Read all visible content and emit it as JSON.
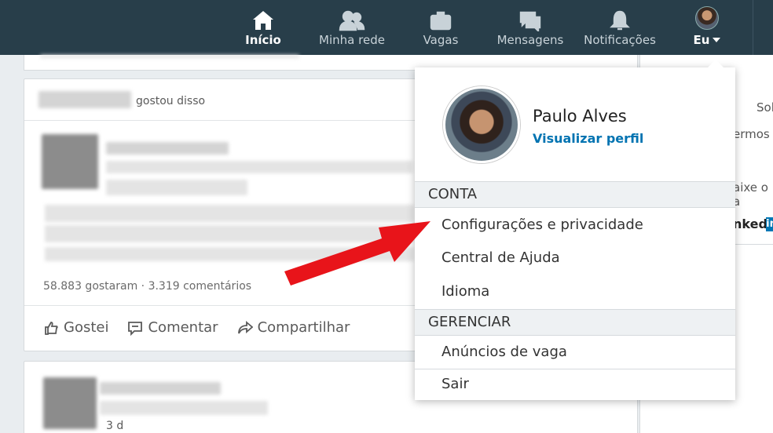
{
  "nav": {
    "items": [
      {
        "label": "Início",
        "icon": "home-icon",
        "active": true
      },
      {
        "label": "Minha rede",
        "icon": "people-icon"
      },
      {
        "label": "Vagas",
        "icon": "briefcase-icon"
      },
      {
        "label": "Mensagens",
        "icon": "messages-icon"
      },
      {
        "label": "Notificações",
        "icon": "bell-icon"
      }
    ],
    "me_label": "Eu"
  },
  "feed": {
    "post1": {
      "liked_by_suffix": "gostou disso",
      "stats": "58.883 gostaram · 3.319 comentários",
      "actions": {
        "like": "Gostei",
        "comment": "Comentar",
        "share": "Compartilhar"
      }
    },
    "post2": {
      "time_ago": "3 d"
    }
  },
  "rail": {
    "text1": "Sol",
    "text2": "ermos",
    "text3": "aixe o a",
    "brand_text": "nked",
    "brand_badge": "in"
  },
  "dropdown": {
    "profile": {
      "name": "Paulo Alves",
      "link": "Visualizar perfil"
    },
    "account_header": "CONTA",
    "account_items": [
      "Configurações e privacidade",
      "Central de Ajuda",
      "Idioma"
    ],
    "manage_header": "GERENCIAR",
    "manage_items": [
      "Anúncios de vaga"
    ],
    "signout": "Sair"
  },
  "colors": {
    "topbar": "#283e4a",
    "link": "#0073b1",
    "arrow": "#e8141a"
  }
}
